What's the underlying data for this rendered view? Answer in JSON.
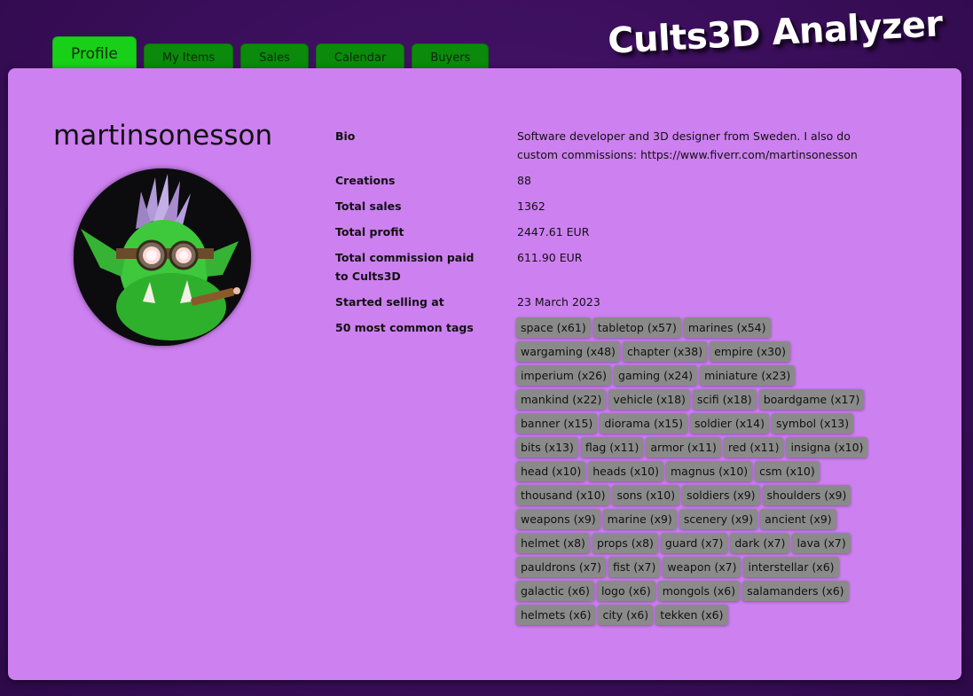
{
  "app_title": "Cults3D Analyzer",
  "tabs": [
    {
      "label": "Profile",
      "active": true
    },
    {
      "label": "My Items",
      "active": false
    },
    {
      "label": "Sales",
      "active": false
    },
    {
      "label": "Calendar",
      "active": false
    },
    {
      "label": "Buyers",
      "active": false
    }
  ],
  "profile": {
    "username": "martinsonesson",
    "avatar_icon": "orc-avatar"
  },
  "info": {
    "bio_label": "Bio",
    "bio_value": "Software developer and 3D designer from Sweden. I also do custom commissions: https://www.fiverr.com/martinsonesson",
    "creations_label": "Creations",
    "creations_value": "88",
    "sales_label": "Total sales",
    "sales_value": "1362",
    "profit_label": "Total profit",
    "profit_value": "2447.61 EUR",
    "commission_label": "Total commission paid to Cults3D",
    "commission_value": "611.90 EUR",
    "started_label": "Started selling at",
    "started_value": "23 March 2023",
    "tags_label": "50 most common tags"
  },
  "tags": [
    "space (x61)",
    "tabletop (x57)",
    "marines (x54)",
    "wargaming (x48)",
    "chapter (x38)",
    "empire (x30)",
    "imperium (x26)",
    "gaming (x24)",
    "miniature (x23)",
    "mankind (x22)",
    "vehicle (x18)",
    "scifi (x18)",
    "boardgame (x17)",
    "banner (x15)",
    "diorama (x15)",
    "soldier (x14)",
    "symbol (x13)",
    "bits (x13)",
    "flag (x11)",
    "armor (x11)",
    "red (x11)",
    "insigna (x10)",
    "head (x10)",
    "heads (x10)",
    "magnus (x10)",
    "csm (x10)",
    "thousand (x10)",
    "sons (x10)",
    "soldiers (x9)",
    "shoulders (x9)",
    "weapons (x9)",
    "marine (x9)",
    "scenery (x9)",
    "ancient (x9)",
    "helmet (x8)",
    "props (x8)",
    "guard (x7)",
    "dark (x7)",
    "lava (x7)",
    "pauldrons (x7)",
    "fist (x7)",
    "weapon (x7)",
    "interstellar (x6)",
    "galactic (x6)",
    "logo (x6)",
    "mongols (x6)",
    "salamanders (x6)",
    "helmets (x6)",
    "city (x6)",
    "tekken (x6)"
  ],
  "tag_rows": [
    3,
    3,
    3,
    4,
    4,
    5,
    4,
    4,
    4,
    5,
    4,
    4,
    3
  ]
}
